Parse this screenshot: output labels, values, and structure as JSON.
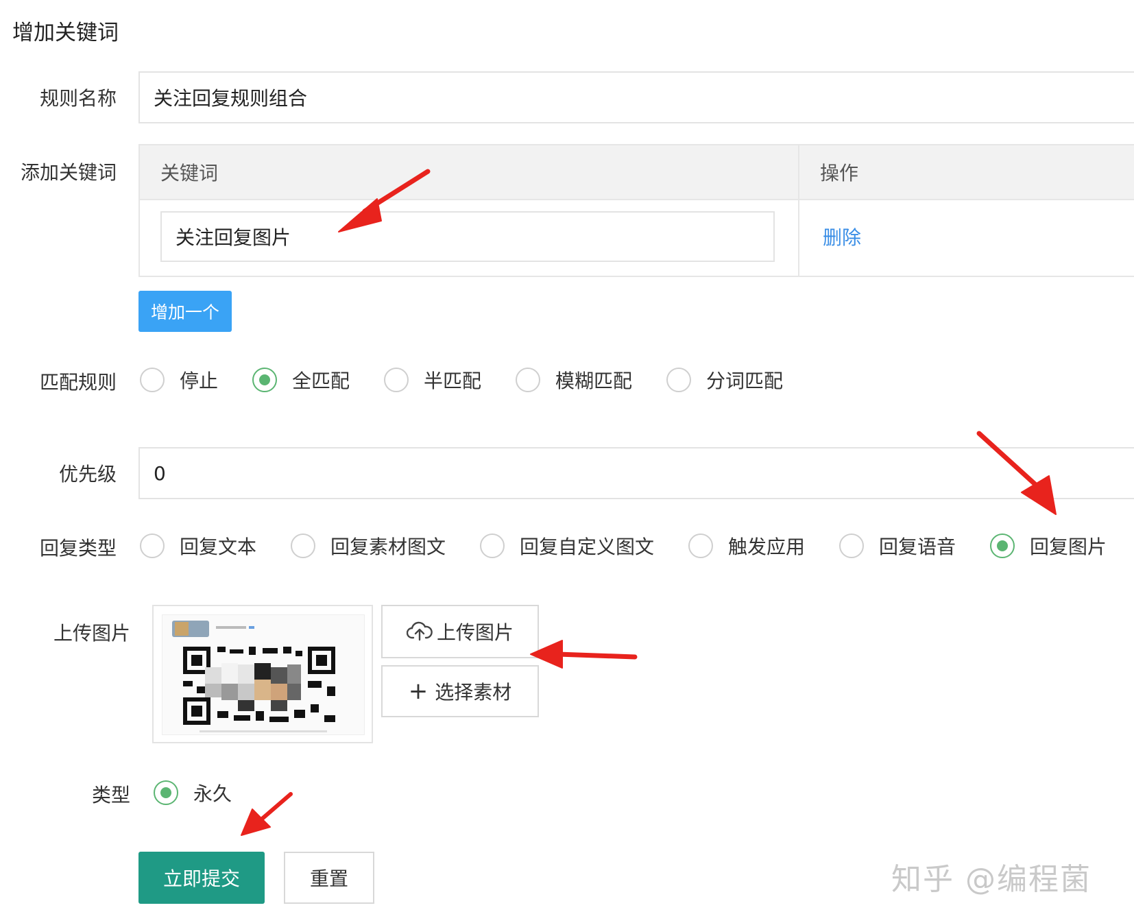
{
  "title": "增加关键词",
  "rule_name": {
    "label": "规则名称",
    "value": "关注回复规则组合"
  },
  "keywords": {
    "label": "添加关键词",
    "headers": [
      "关键词",
      "操作"
    ],
    "rows": [
      {
        "keyword": "关注回复图片",
        "action": "删除"
      }
    ],
    "add_button": "增加一个"
  },
  "match_rule": {
    "label": "匹配规则",
    "options": [
      "停止",
      "全匹配",
      "半匹配",
      "模糊匹配",
      "分词匹配"
    ],
    "selected": "全匹配"
  },
  "priority": {
    "label": "优先级",
    "value": "0"
  },
  "reply_type": {
    "label": "回复类型",
    "options": [
      "回复文本",
      "回复素材图文",
      "回复自定义图文",
      "触发应用",
      "回复语音",
      "回复图片"
    ],
    "selected": "回复图片"
  },
  "upload": {
    "label": "上传图片",
    "upload_button": "上传图片",
    "select_button": "选择素材"
  },
  "type": {
    "label": "类型",
    "option": "永久"
  },
  "actions": {
    "submit": "立即提交",
    "reset": "重置"
  },
  "watermark": "知乎 @编程菌",
  "colors": {
    "accent_blue": "#3aa3f5",
    "radio_green": "#5bb572",
    "submit_teal": "#1f9a85",
    "link_blue": "#3a8ee6",
    "arrow_red": "#e8231d"
  }
}
